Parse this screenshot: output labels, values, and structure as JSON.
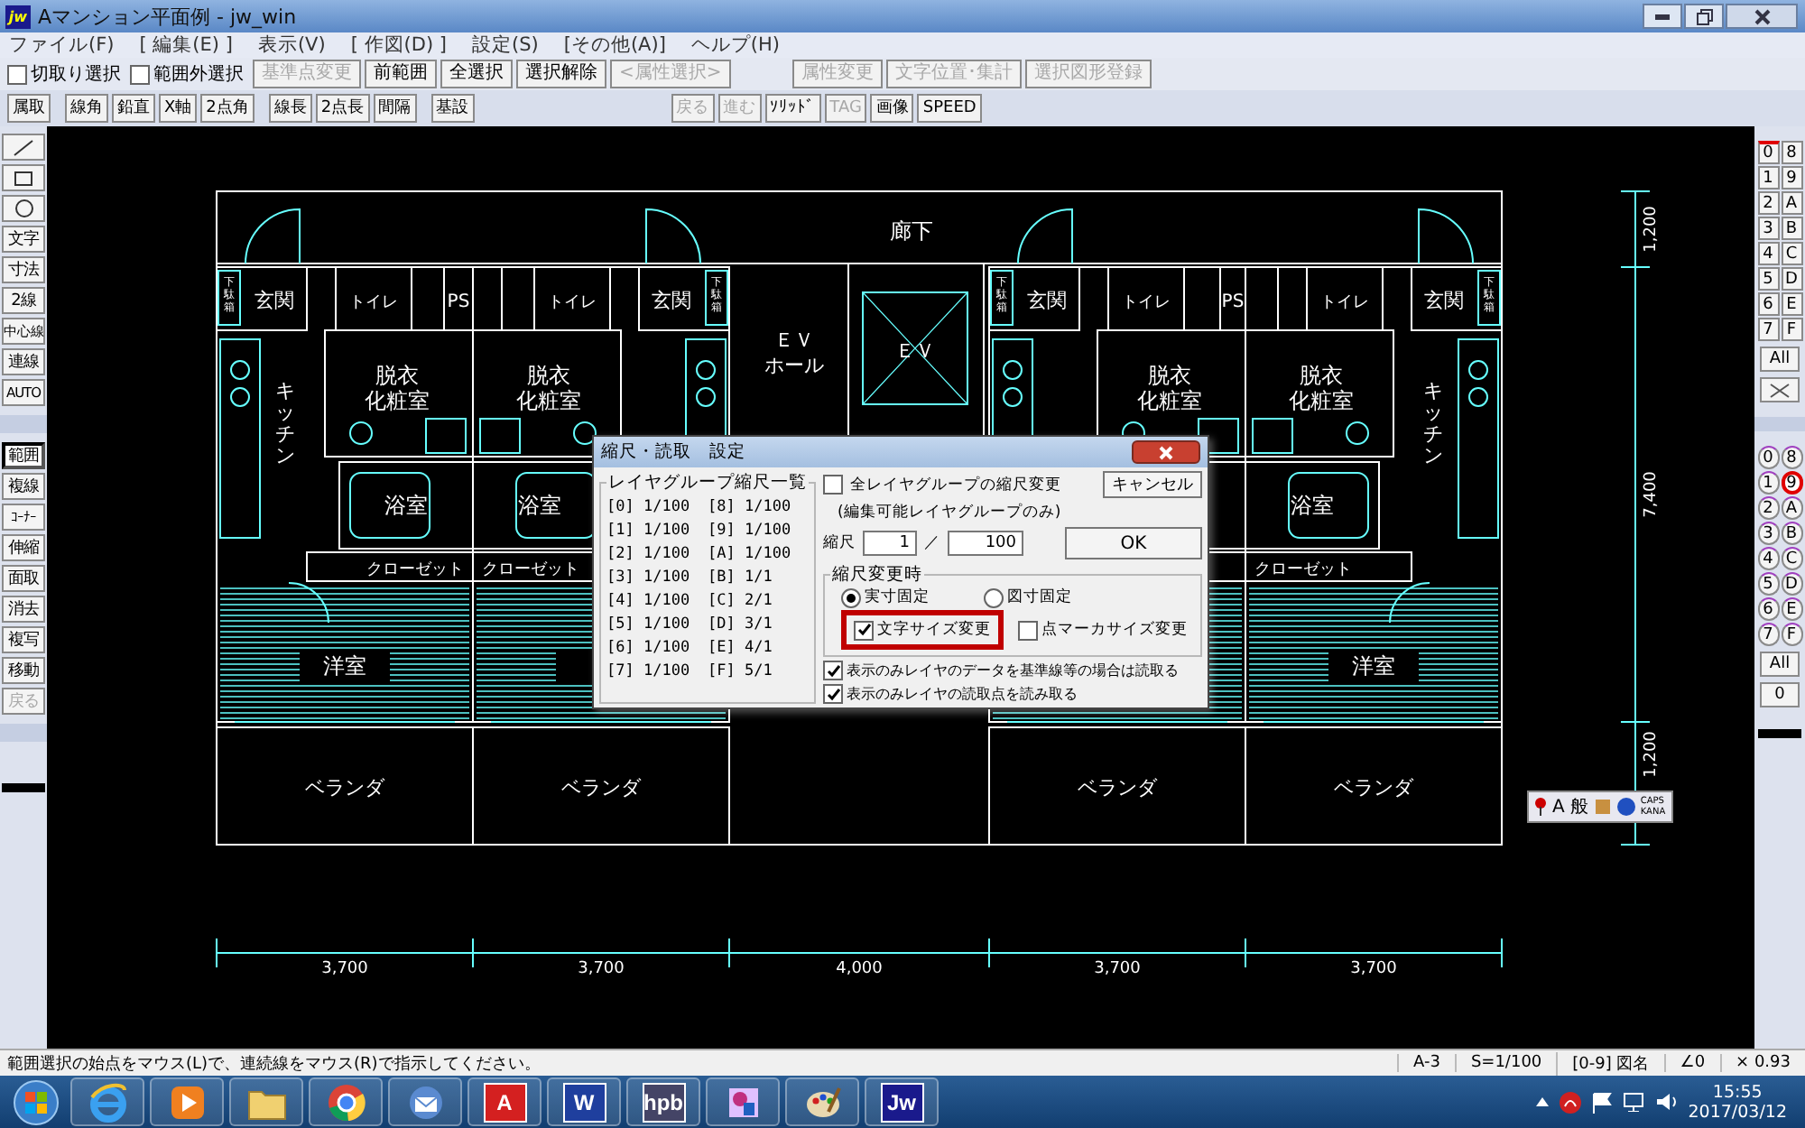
{
  "window": {
    "title": "Aマンション平面例 - jw_win",
    "app_icon": "jw"
  },
  "menu": [
    "ファイル(F)",
    "[ 編集(E) ]",
    "表示(V)",
    "[ 作図(D) ]",
    "設定(S)",
    "[その他(A)]",
    "ヘルプ(H)"
  ],
  "toolbar_top": {
    "checkboxes": [
      {
        "label": "切取り選択",
        "checked": false
      },
      {
        "label": "範囲外選択",
        "checked": false
      }
    ],
    "buttons": [
      {
        "label": "基準点変更",
        "disabled": true
      },
      {
        "label": "前範囲",
        "disabled": false
      },
      {
        "label": "全選択",
        "disabled": false
      },
      {
        "label": "選択解除",
        "disabled": false
      },
      {
        "label": "<属性選択>",
        "disabled": true
      },
      {
        "label": "属性変更",
        "disabled": true
      },
      {
        "label": "文字位置･集計",
        "disabled": true
      },
      {
        "label": "選択図形登録",
        "disabled": true
      }
    ]
  },
  "toolbar_second": {
    "left": [
      {
        "label": "属取",
        "disabled": false
      },
      {
        "label": "線角",
        "disabled": false
      },
      {
        "label": "鉛直",
        "disabled": false
      },
      {
        "label": "X軸",
        "disabled": false
      },
      {
        "label": "2点角",
        "disabled": false
      },
      {
        "label": "線長",
        "disabled": false
      },
      {
        "label": "2点長",
        "disabled": false
      },
      {
        "label": "間隔",
        "disabled": false
      },
      {
        "label": "基設",
        "disabled": false
      }
    ],
    "right": [
      {
        "label": "戻る",
        "disabled": true
      },
      {
        "label": "進む",
        "disabled": true
      },
      {
        "label": "ｿﾘｯﾄﾞ",
        "disabled": false
      },
      {
        "label": "TAG",
        "disabled": true
      },
      {
        "label": "画像",
        "disabled": false
      },
      {
        "label": "SPEED",
        "disabled": false
      }
    ]
  },
  "tool_palette": {
    "draw": [
      {
        "label": "文字",
        "selected": false,
        "disabled": false
      },
      {
        "label": "寸法",
        "selected": false,
        "disabled": false
      },
      {
        "label": "2線",
        "selected": false,
        "disabled": false
      },
      {
        "label": "中心線",
        "selected": false,
        "disabled": false
      },
      {
        "label": "連線",
        "selected": false,
        "disabled": false
      },
      {
        "label": "AUTO",
        "selected": false,
        "disabled": false
      }
    ],
    "edit": [
      {
        "label": "範囲",
        "selected": true,
        "disabled": false
      },
      {
        "label": "複線",
        "selected": false,
        "disabled": false
      },
      {
        "label": "ｺｰﾅｰ",
        "selected": false,
        "disabled": false
      },
      {
        "label": "伸縮",
        "selected": false,
        "disabled": false
      },
      {
        "label": "面取",
        "selected": false,
        "disabled": false
      },
      {
        "label": "消去",
        "selected": false,
        "disabled": false
      },
      {
        "label": "複写",
        "selected": false,
        "disabled": false
      },
      {
        "label": "移動",
        "selected": false,
        "disabled": false
      },
      {
        "label": "戻る",
        "selected": false,
        "disabled": true
      }
    ]
  },
  "layer_panel": {
    "groups": [
      {
        "label": "0",
        "selected": true
      },
      {
        "label": "8",
        "selected": false
      },
      {
        "label": "1",
        "selected": false
      },
      {
        "label": "9",
        "selected": false
      },
      {
        "label": "2",
        "selected": false
      },
      {
        "label": "A",
        "selected": false
      },
      {
        "label": "3",
        "selected": false
      },
      {
        "label": "B",
        "selected": false
      },
      {
        "label": "4",
        "selected": false
      },
      {
        "label": "C",
        "selected": false
      },
      {
        "label": "5",
        "selected": false
      },
      {
        "label": "D",
        "selected": false
      },
      {
        "label": "6",
        "selected": false
      },
      {
        "label": "E",
        "selected": false
      },
      {
        "label": "7",
        "selected": false
      },
      {
        "label": "F",
        "selected": false
      }
    ],
    "groups_all": "All",
    "layers": [
      {
        "label": "0",
        "selected": false
      },
      {
        "label": "8",
        "selected": false
      },
      {
        "label": "1",
        "selected": false
      },
      {
        "label": "9",
        "selected": true
      },
      {
        "label": "2",
        "selected": false
      },
      {
        "label": "A",
        "selected": false
      },
      {
        "label": "3",
        "selected": false
      },
      {
        "label": "B",
        "selected": false
      },
      {
        "label": "4",
        "selected": false
      },
      {
        "label": "C",
        "selected": false
      },
      {
        "label": "5",
        "selected": false
      },
      {
        "label": "D",
        "selected": false
      },
      {
        "label": "6",
        "selected": false
      },
      {
        "label": "E",
        "selected": false
      },
      {
        "label": "7",
        "selected": false
      },
      {
        "label": "F",
        "selected": false
      }
    ],
    "layers_all": "All",
    "layer_zero": "0"
  },
  "drawing": {
    "corridor": "廊下",
    "ev_hall": [
      "ＥＶ",
      "ホール"
    ],
    "ev": "ＥＶ",
    "ps": [
      "PS",
      "PS"
    ],
    "units": [
      {
        "entrance": "玄関",
        "shoe_box": "下駄箱",
        "toilet": "トイレ",
        "kitchen": "キッチン",
        "dressing": [
          "脱衣",
          "化粧室"
        ],
        "bath": "浴室",
        "closet": "クローゼット",
        "room": "洋室",
        "balcony": "ベランダ"
      },
      {
        "entrance": "玄関",
        "shoe_box": "下駄箱",
        "toilet": "トイレ",
        "dressing": [
          "脱衣",
          "化粧室"
        ],
        "bath": "浴室",
        "closet": "クローゼット",
        "balcony": "ベランダ"
      },
      {
        "entrance": "玄関",
        "shoe_box": "下駄箱",
        "toilet": "トイレ",
        "dressing": [
          "脱衣",
          "化粧室"
        ],
        "balcony": "ベランダ"
      },
      {
        "entrance": "玄関",
        "shoe_box": "下駄箱",
        "toilet": "トイレ",
        "kitchen": "キッチン",
        "dressing": [
          "脱衣",
          "化粧室"
        ],
        "bath": "浴室",
        "closet": "クローゼット",
        "room": "洋室",
        "balcony": "ベランダ"
      }
    ],
    "dimensions_horizontal": [
      "3,700",
      "3,700",
      "4,000",
      "3,700",
      "3,700"
    ],
    "dimensions_vertical": [
      "1,200",
      "7,400",
      "1,200"
    ]
  },
  "scale_dialog": {
    "title": "縮尺・読取　設定",
    "list_title": "レイヤグループ縮尺一覧",
    "list": [
      {
        "id": "[0]",
        "scale": "1/100"
      },
      {
        "id": "[8]",
        "scale": "1/100"
      },
      {
        "id": "[1]",
        "scale": "1/100"
      },
      {
        "id": "[9]",
        "scale": "1/100"
      },
      {
        "id": "[2]",
        "scale": "1/100"
      },
      {
        "id": "[A]",
        "scale": "1/100"
      },
      {
        "id": "[3]",
        "scale": "1/100"
      },
      {
        "id": "[B]",
        "scale": "1/1"
      },
      {
        "id": "[4]",
        "scale": "1/100"
      },
      {
        "id": "[C]",
        "scale": "2/1"
      },
      {
        "id": "[5]",
        "scale": "1/100"
      },
      {
        "id": "[D]",
        "scale": "3/1"
      },
      {
        "id": "[6]",
        "scale": "1/100"
      },
      {
        "id": "[E]",
        "scale": "4/1"
      },
      {
        "id": "[7]",
        "scale": "1/100"
      },
      {
        "id": "[F]",
        "scale": "5/1"
      }
    ],
    "all_groups": {
      "label": "全レイヤグループの縮尺変更",
      "checked": false
    },
    "all_groups_note": "(編集可能レイヤグループのみ)",
    "cancel": "キャンセル",
    "ok": "OK",
    "scale_label": "縮尺",
    "numerator": "1",
    "separator": "／",
    "denominator": "100",
    "change_group": "縮尺変更時",
    "radios": [
      {
        "label": "実寸固定",
        "selected": true
      },
      {
        "label": "図寸固定",
        "selected": false
      }
    ],
    "size_options": [
      {
        "label": "文字サイズ変更",
        "checked": true
      },
      {
        "label": "点マーカサイズ変更",
        "checked": false
      }
    ],
    "read_options": [
      {
        "label": "表示のみレイヤのデータを基準線等の場合は読取る",
        "checked": true
      },
      {
        "label": "表示のみレイヤの読取点を読み取る",
        "checked": true
      }
    ]
  },
  "ime_bar": {
    "texts": [
      "A",
      "般"
    ],
    "caps": "CAPS",
    "kana": "KANA"
  },
  "status_bar": {
    "message": "範囲選択の始点をマウス(L)で、連続線をマウス(R)で指示してください。",
    "fields": [
      "A-3",
      "S=1/100",
      "[0-9] 図名",
      "∠0",
      "× 0.93"
    ]
  },
  "taskbar": {
    "apps": [
      {
        "kind": "ie"
      },
      {
        "kind": "media"
      },
      {
        "kind": "folder"
      },
      {
        "kind": "chrome"
      },
      {
        "kind": "mail"
      },
      {
        "kind": "letter",
        "label": "A",
        "color": "#d42020"
      },
      {
        "kind": "letter",
        "label": "W",
        "color": "#1f3f9e"
      },
      {
        "kind": "letter",
        "label": "hpb",
        "color": "#444466"
      },
      {
        "kind": "paint"
      },
      {
        "kind": "palette"
      },
      {
        "kind": "letter",
        "label": "Jw",
        "color": "#1a1a8c"
      }
    ],
    "time": "15:55",
    "date": "2017/03/12"
  }
}
